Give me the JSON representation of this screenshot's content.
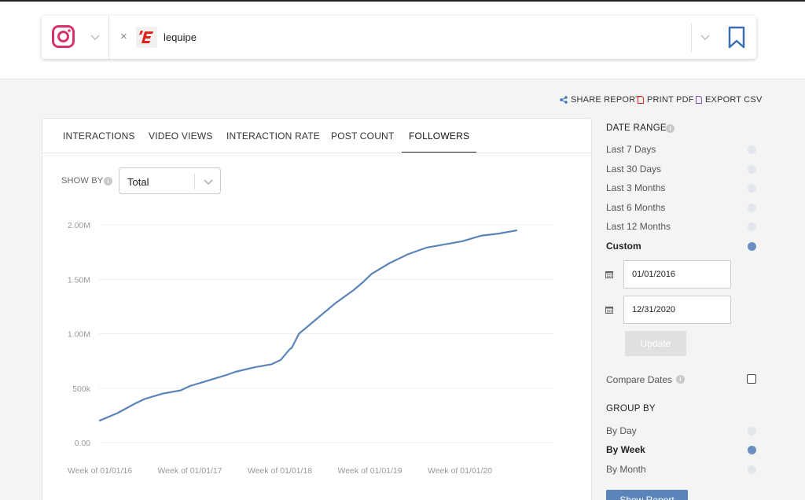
{
  "header": {
    "platform_icon": "instagram-icon",
    "remove_label": "×",
    "brand_logo_text": "'E",
    "brand_name": "lequipe",
    "bookmark_icon": "bookmark-icon"
  },
  "actions": {
    "share": "SHARE REPORT",
    "print": "PRINT PDF",
    "export": "EXPORT CSV"
  },
  "tabs": [
    "INTERACTIONS",
    "VIDEO VIEWS",
    "INTERACTION RATE",
    "POST COUNT",
    "FOLLOWERS"
  ],
  "active_tab": "FOLLOWERS",
  "show_by": {
    "label": "SHOW BY",
    "value": "Total"
  },
  "chart_data": {
    "type": "line",
    "title": "",
    "xlabel": "",
    "ylabel": "",
    "y_ticks": [
      "0.00",
      "500k",
      "1.00M",
      "1.50M",
      "2.00M"
    ],
    "x_ticks": [
      "Week of 01/01/16",
      "Week of 01/01/17",
      "Week of 01/01/18",
      "Week of 01/01/19",
      "Week of 01/01/20"
    ],
    "ylim": [
      0,
      2000000
    ],
    "grid": "horizontal",
    "line_color": "#5b84b8",
    "series": [
      {
        "x": [
          2016.0,
          2016.2,
          2016.4,
          2016.5,
          2016.7,
          2016.9,
          2017.0,
          2017.2,
          2017.4,
          2017.5,
          2017.7,
          2017.9,
          2018.0,
          2018.1,
          2018.12,
          2018.2,
          2018.4,
          2018.6,
          2018.8,
          2018.9,
          2019.0,
          2019.2,
          2019.4,
          2019.6,
          2019.8,
          2020.0,
          2020.2,
          2020.4,
          2020.6
        ],
        "y": [
          200000,
          270000,
          360000,
          400000,
          450000,
          480000,
          520000,
          570000,
          620000,
          650000,
          690000,
          720000,
          760000,
          860000,
          870000,
          1000000,
          1140000,
          1280000,
          1400000,
          1470000,
          1550000,
          1650000,
          1730000,
          1790000,
          1820000,
          1850000,
          1900000,
          1920000,
          1950000
        ]
      }
    ]
  },
  "sidebar": {
    "date_range_title": "DATE RANGE",
    "date_options": [
      {
        "label": "Last 7 Days",
        "selected": false
      },
      {
        "label": "Last 30 Days",
        "selected": false
      },
      {
        "label": "Last 3 Months",
        "selected": false
      },
      {
        "label": "Last 6 Months",
        "selected": false
      },
      {
        "label": "Last 12 Months",
        "selected": false
      },
      {
        "label": "Custom",
        "selected": true
      }
    ],
    "start_date": "01/01/2016",
    "end_date": "12/31/2020",
    "update_label": "Update",
    "compare_label": "Compare Dates",
    "compare_checked": false,
    "group_by_title": "GROUP BY",
    "group_options": [
      {
        "label": "By Day",
        "selected": false
      },
      {
        "label": "By Week",
        "selected": true
      },
      {
        "label": "By Month",
        "selected": false
      }
    ],
    "show_report_label": "Show Report"
  }
}
